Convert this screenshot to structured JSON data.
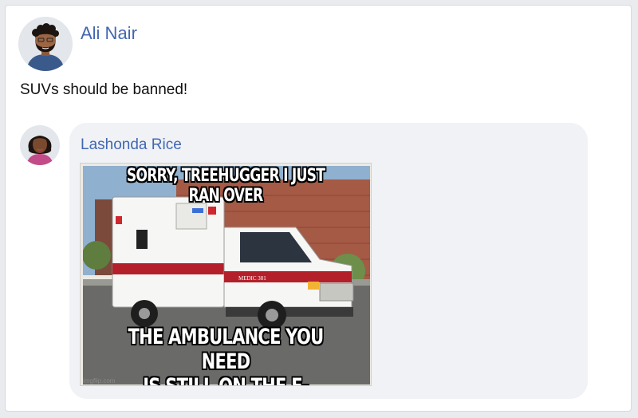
{
  "post": {
    "author": "Ali Nair",
    "text": "SUVs should be banned!"
  },
  "comment": {
    "author": "Lashonda Rice",
    "meme": {
      "top_text": "SORRY, TREEHUGGER I JUST RAN OVER",
      "bottom_text_line1": "THE AMBULANCE YOU NEED",
      "bottom_text_line2": "IS STILL ON THE E-CHARGER",
      "watermark": "imgflip.com",
      "vehicle_label": "MEDIC 381"
    }
  },
  "colors": {
    "link_blue": "#4267b2",
    "bubble_bg": "#f0f2f5",
    "ambulance_red": "#b3202a"
  }
}
